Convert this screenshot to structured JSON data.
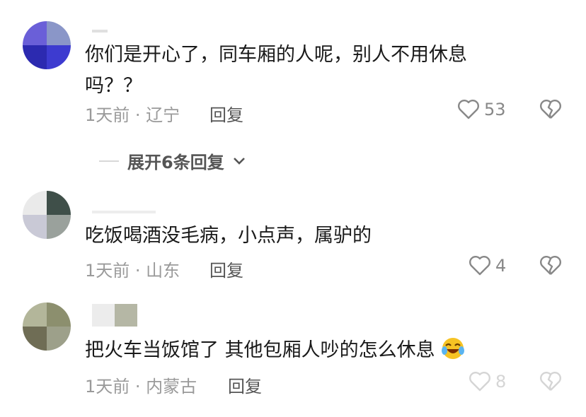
{
  "comments": [
    {
      "text": "你们是开心了，同车厢的人呢，别人不用休息吗？？",
      "time_location": "1天前 · 辽宁",
      "reply_label": "回复",
      "like_count": "53"
    },
    {
      "text": "吃饭喝酒没毛病，小点声，属驴的",
      "time_location": "1天前 · 山东",
      "reply_label": "回复",
      "like_count": "4"
    },
    {
      "text": "把火车当饭馆了 其他包厢人吵的怎么休息",
      "time_location": "1天前 · 内蒙古",
      "reply_label": "回复",
      "like_count": "8"
    }
  ],
  "expand_replies_label": "展开6条回复",
  "colors": {
    "avatar1": [
      "#2c2ab0",
      "#6a5fd8",
      "#8a96c8",
      "#3d3bd0"
    ],
    "avatar2": [
      "#c9c9d6",
      "#3f4f49",
      "#9aa19c",
      "#eaeaea"
    ],
    "avatar3": [
      "#b3b69a",
      "#8c8f6e",
      "#9da08a",
      "#6f6d55"
    ]
  }
}
